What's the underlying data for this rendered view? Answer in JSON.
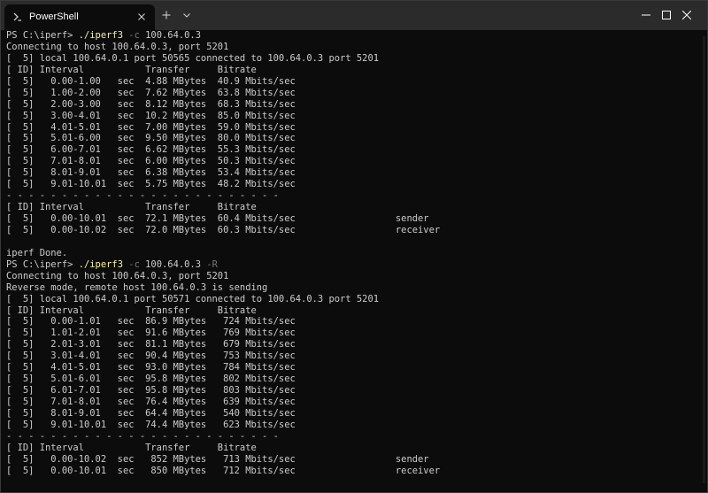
{
  "window": {
    "tab_title": "PowerShell",
    "tab_icon": "powershell-icon"
  },
  "terminal": {
    "lines": [
      [
        {
          "t": "PS C:\\iperf> "
        },
        {
          "t": "./iperf3",
          "c": "cmd"
        },
        {
          "t": " "
        },
        {
          "t": "-c",
          "c": "param"
        },
        {
          "t": " 100.64.0.3"
        }
      ],
      [
        {
          "t": "Connecting to host 100.64.0.3, port 5201"
        }
      ],
      [
        {
          "t": "[  5] local 100.64.0.1 port 50565 connected to 100.64.0.3 port 5201"
        }
      ],
      [
        {
          "t": "[ ID] Interval           Transfer     Bitrate"
        }
      ],
      [
        {
          "t": "[  5]   0.00-1.00   sec  4.88 MBytes  40.9 Mbits/sec"
        }
      ],
      [
        {
          "t": "[  5]   1.00-2.00   sec  7.62 MBytes  63.8 Mbits/sec"
        }
      ],
      [
        {
          "t": "[  5]   2.00-3.00   sec  8.12 MBytes  68.3 Mbits/sec"
        }
      ],
      [
        {
          "t": "[  5]   3.00-4.01   sec  10.2 MBytes  85.0 Mbits/sec"
        }
      ],
      [
        {
          "t": "[  5]   4.01-5.01   sec  7.00 MBytes  59.0 Mbits/sec"
        }
      ],
      [
        {
          "t": "[  5]   5.01-6.00   sec  9.50 MBytes  80.0 Mbits/sec"
        }
      ],
      [
        {
          "t": "[  5]   6.00-7.01   sec  6.62 MBytes  55.3 Mbits/sec"
        }
      ],
      [
        {
          "t": "[  5]   7.01-8.01   sec  6.00 MBytes  50.3 Mbits/sec"
        }
      ],
      [
        {
          "t": "[  5]   8.01-9.01   sec  6.38 MBytes  53.4 Mbits/sec"
        }
      ],
      [
        {
          "t": "[  5]   9.01-10.01  sec  5.75 MBytes  48.2 Mbits/sec"
        }
      ],
      [
        {
          "t": "- - - - - - - - - - - - - - - - - - - - - - - - -"
        }
      ],
      [
        {
          "t": "[ ID] Interval           Transfer     Bitrate"
        }
      ],
      [
        {
          "t": "[  5]   0.00-10.01  sec  72.1 MBytes  60.4 Mbits/sec                  sender"
        }
      ],
      [
        {
          "t": "[  5]   0.00-10.02  sec  72.0 MBytes  60.3 Mbits/sec                  receiver"
        }
      ],
      [
        {
          "t": ""
        }
      ],
      [
        {
          "t": "iperf Done."
        }
      ],
      [
        {
          "t": "PS C:\\iperf> "
        },
        {
          "t": "./iperf3",
          "c": "cmd"
        },
        {
          "t": " "
        },
        {
          "t": "-c",
          "c": "param"
        },
        {
          "t": " 100.64.0.3 "
        },
        {
          "t": "-R",
          "c": "param"
        }
      ],
      [
        {
          "t": "Connecting to host 100.64.0.3, port 5201"
        }
      ],
      [
        {
          "t": "Reverse mode, remote host 100.64.0.3 is sending"
        }
      ],
      [
        {
          "t": "[  5] local 100.64.0.1 port 50571 connected to 100.64.0.3 port 5201"
        }
      ],
      [
        {
          "t": "[ ID] Interval           Transfer     Bitrate"
        }
      ],
      [
        {
          "t": "[  5]   0.00-1.01   sec  86.9 MBytes   724 Mbits/sec"
        }
      ],
      [
        {
          "t": "[  5]   1.01-2.01   sec  91.6 MBytes   769 Mbits/sec"
        }
      ],
      [
        {
          "t": "[  5]   2.01-3.01   sec  81.1 MBytes   679 Mbits/sec"
        }
      ],
      [
        {
          "t": "[  5]   3.01-4.01   sec  90.4 MBytes   753 Mbits/sec"
        }
      ],
      [
        {
          "t": "[  5]   4.01-5.01   sec  93.0 MBytes   784 Mbits/sec"
        }
      ],
      [
        {
          "t": "[  5]   5.01-6.01   sec  95.8 MBytes   802 Mbits/sec"
        }
      ],
      [
        {
          "t": "[  5]   6.01-7.01   sec  95.8 MBytes   803 Mbits/sec"
        }
      ],
      [
        {
          "t": "[  5]   7.01-8.01   sec  76.4 MBytes   639 Mbits/sec"
        }
      ],
      [
        {
          "t": "[  5]   8.01-9.01   sec  64.4 MBytes   540 Mbits/sec"
        }
      ],
      [
        {
          "t": "[  5]   9.01-10.01  sec  74.4 MBytes   623 Mbits/sec"
        }
      ],
      [
        {
          "t": "- - - - - - - - - - - - - - - - - - - - - - - - -"
        }
      ],
      [
        {
          "t": "[ ID] Interval           Transfer     Bitrate"
        }
      ],
      [
        {
          "t": "[  5]   0.00-10.02  sec   852 MBytes   713 Mbits/sec                  sender"
        }
      ],
      [
        {
          "t": "[  5]   0.00-10.01  sec   850 MBytes   712 Mbits/sec                  receiver"
        }
      ]
    ]
  },
  "colors": {
    "background": "#0c0c0c",
    "titlebar": "#2b2b2b",
    "text": "#cccccc",
    "command": "#f9f1a5",
    "parameter": "#767676"
  }
}
